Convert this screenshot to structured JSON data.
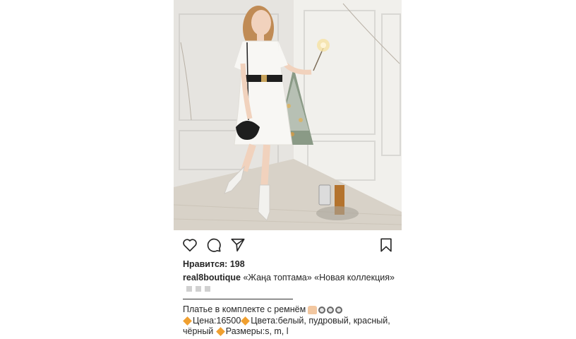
{
  "post": {
    "likes_text": "Нравится: 198",
    "username": "real8boutique",
    "caption": "«Жаңа топтама» «Новая коллекция»",
    "line1": "Платье в комплекте с ремнём",
    "price": "Цена:16500",
    "colors": "Цвета:белый, пудровый, красный, чёрный",
    "sizes": "Размеры:s, m, l"
  },
  "icons": {
    "like": "heart-icon",
    "comment": "comment-icon",
    "share": "send-icon",
    "save": "bookmark-icon"
  }
}
